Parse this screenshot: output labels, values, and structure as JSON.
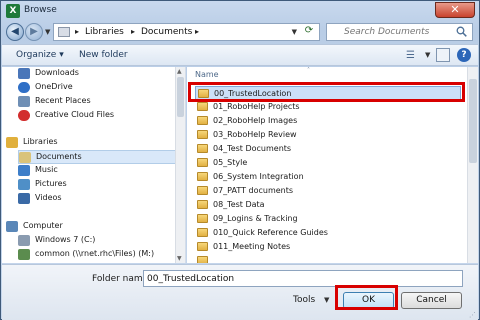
{
  "window": {
    "title": "Browse",
    "app_icon_letter": "X"
  },
  "nav": {
    "breadcrumb": [
      "Libraries",
      "Documents"
    ],
    "search_placeholder": "Search Documents"
  },
  "toolbar": {
    "organize": "Organize",
    "new_folder": "New folder"
  },
  "left_pane": {
    "items": [
      {
        "label": "Downloads",
        "icon": "downloads-icon",
        "color": "#4a76b9"
      },
      {
        "label": "OneDrive",
        "icon": "onedrive-icon",
        "color": "#2f6fc6"
      },
      {
        "label": "Recent Places",
        "icon": "recent-places-icon",
        "color": "#6f8fb5"
      },
      {
        "label": "Creative Cloud Files",
        "icon": "creative-cloud-icon",
        "color": "#d22d2d"
      },
      {
        "label": "Libraries",
        "icon": "libraries-icon",
        "color": "#e1b03c"
      },
      {
        "label": "Documents",
        "icon": "documents-icon",
        "color": "#d9c37a"
      },
      {
        "label": "Music",
        "icon": "music-icon",
        "color": "#3d7ec9"
      },
      {
        "label": "Pictures",
        "icon": "pictures-icon",
        "color": "#4f8fc7"
      },
      {
        "label": "Videos",
        "icon": "videos-icon",
        "color": "#3a6aa6"
      },
      {
        "label": "Computer",
        "icon": "computer-icon",
        "color": "#5a87b8"
      },
      {
        "label": "Windows 7 (C:)",
        "icon": "drive-icon",
        "color": "#8a9bb0"
      },
      {
        "label": "common (\\\\rnet.rhc\\Files) (M:)",
        "icon": "network-drive-icon",
        "color": "#5b8c4e"
      },
      {
        "label": "",
        "icon": "network-drive-icon",
        "color": "#5b8c4e"
      }
    ]
  },
  "right_pane": {
    "column_header": "Name",
    "files": [
      "00_TrustedLocation",
      "01_RoboHelp Projects",
      "02_RoboHelp Images",
      "03_RoboHelp Review",
      "04_Test Documents",
      "05_Style",
      "06_System Integration",
      "07_PATT documents",
      "08_Test Data",
      "09_Logins & Tracking",
      "010_Quick Reference Guides",
      "011_Meeting Notes",
      ""
    ]
  },
  "bottom": {
    "folder_name_label": "Folder name:",
    "folder_name_value": "00_TrustedLocation",
    "tools": "Tools",
    "ok": "OK",
    "cancel": "Cancel"
  },
  "colors": {
    "highlight": "#d80000",
    "selection": "#cce0f8"
  }
}
